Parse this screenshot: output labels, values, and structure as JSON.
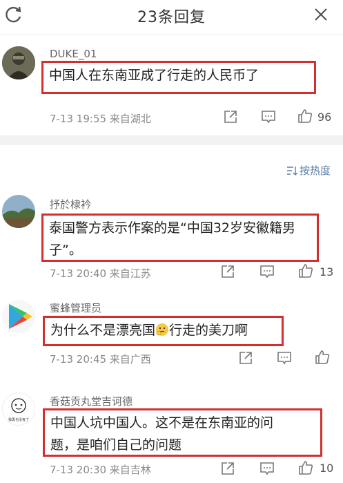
{
  "header": {
    "title": "23条回复"
  },
  "sort_label": "按热度",
  "comments": [
    {
      "user": "DUKE_01",
      "text": "中国人在东南亚成了行走的人民币了",
      "time": "7-13 19:55 来自湖北",
      "likes": "96"
    },
    {
      "user": "抒於棣衿",
      "line1": "泰国警方表示作案的是“中国32岁安徽籍男",
      "line2": "子”。",
      "time": "7-13 20:40 来自江苏",
      "likes": "13"
    },
    {
      "user": "蜜蜂管理员",
      "text_before": "为什么不是漂亮国",
      "text_after": "行走的美刀啊",
      "time": "7-13 20:45 来自广西",
      "likes": ""
    },
    {
      "user": "香菇贡丸堂吉诃德",
      "line1": "中国人坑中国人。这不是在东南亚的问",
      "line2": "题，是咱们自己的问题",
      "time": "7-13 20:30 来自吉林",
      "likes": "10",
      "avatar_caption": "我再也没有了"
    }
  ]
}
